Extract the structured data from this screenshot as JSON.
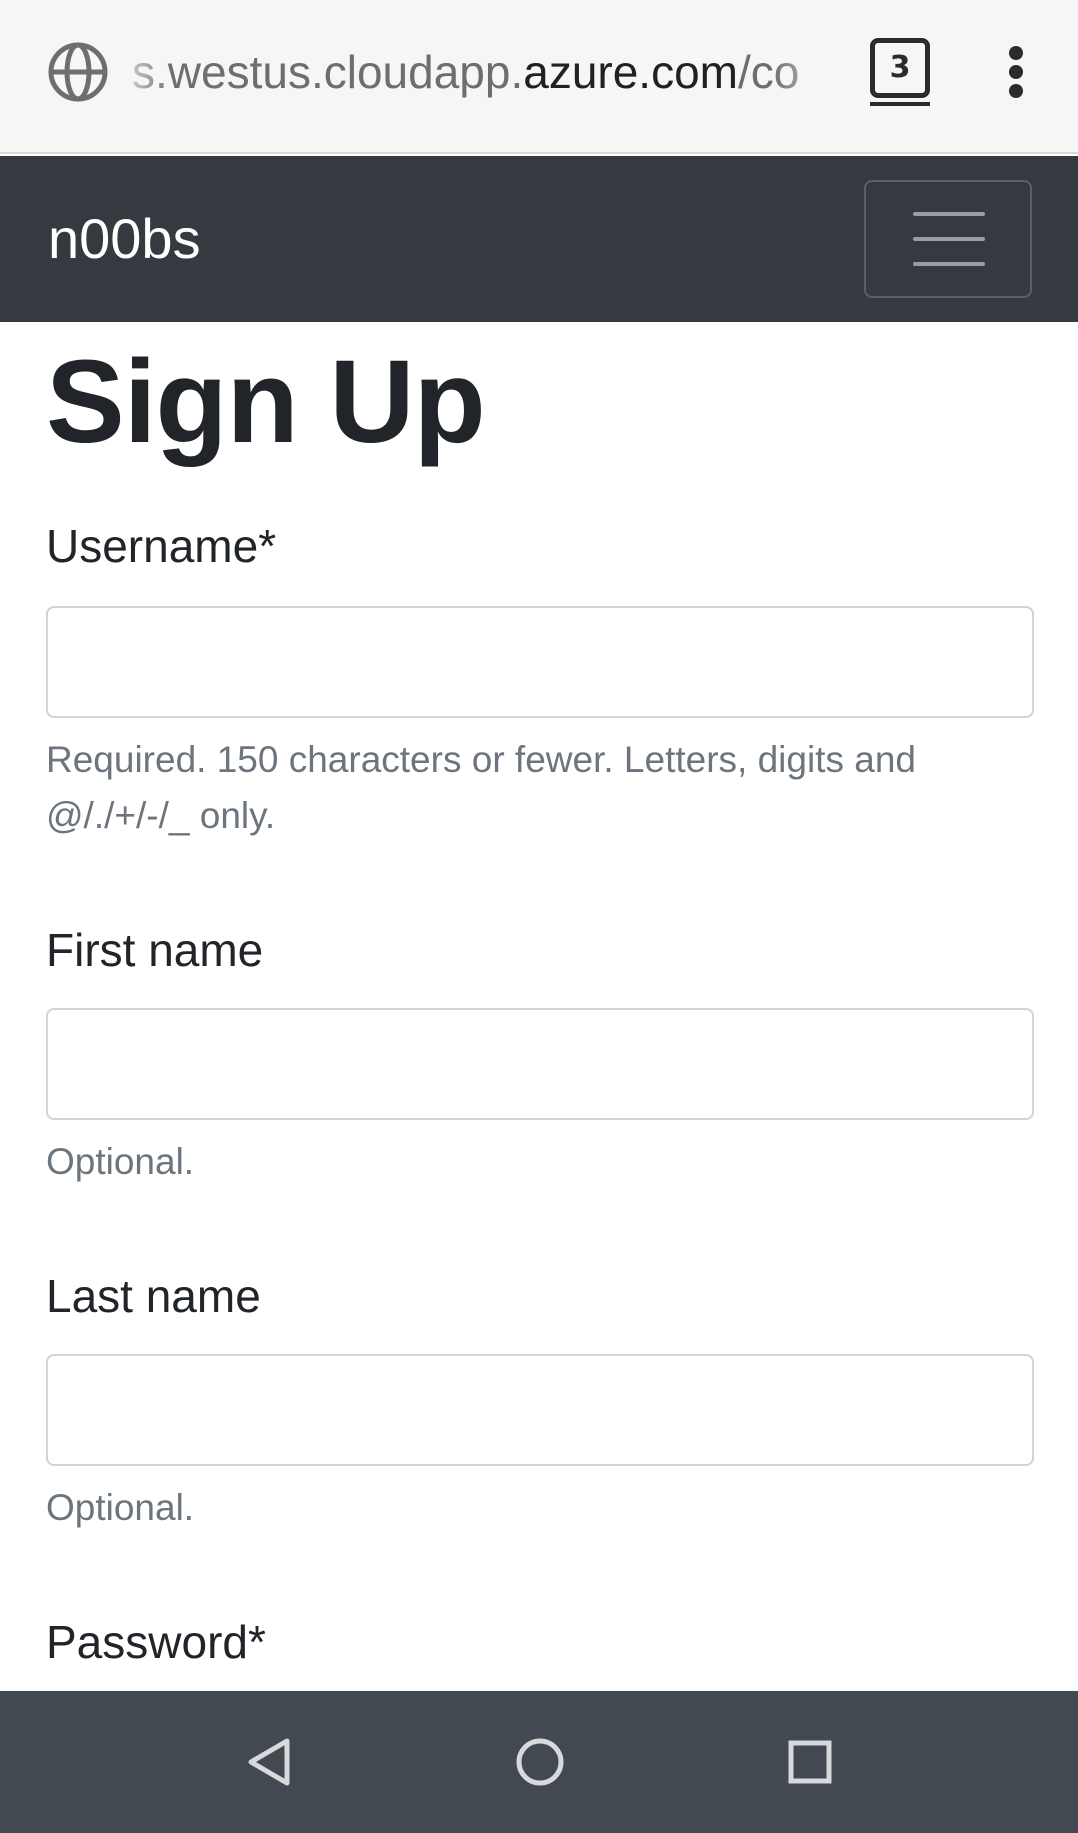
{
  "browser": {
    "url_prefix": "s.westus.cloudapp.",
    "url_host": "azure.com",
    "url_suffix": "/co",
    "tab_count": "3",
    "icons": {
      "site": "globe-icon",
      "tabs": "tab-switcher-icon",
      "menu": "more-vert-icon"
    }
  },
  "navbar": {
    "brand": "n00bs",
    "toggler_icon": "hamburger-icon",
    "background": "#343a40"
  },
  "page": {
    "title": "Sign Up"
  },
  "form": {
    "username": {
      "label": "Username*",
      "value": "",
      "help_line1": "Required. 150 characters or fewer. Letters, digits and",
      "help_line2": "@/./+/-/_ only."
    },
    "first_name": {
      "label": "First name",
      "value": "",
      "help": "Optional."
    },
    "last_name": {
      "label": "Last name",
      "value": "",
      "help": "Optional."
    },
    "password": {
      "label": "Password*"
    }
  },
  "android_nav": {
    "icons": [
      "back-icon",
      "home-icon",
      "recents-icon"
    ]
  }
}
